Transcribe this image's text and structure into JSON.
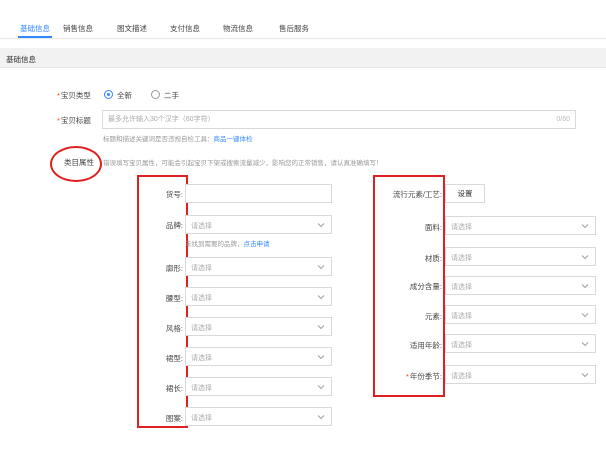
{
  "tabs": [
    {
      "label": "基础信息",
      "active": true
    },
    {
      "label": "销售信息",
      "active": false
    },
    {
      "label": "图文描述",
      "active": false
    },
    {
      "label": "支付信息",
      "active": false
    },
    {
      "label": "物流信息",
      "active": false
    },
    {
      "label": "售后服务",
      "active": false
    }
  ],
  "section": {
    "title": "基础信息"
  },
  "item_type": {
    "required_mark": "*",
    "label": "宝贝类型",
    "options": [
      {
        "label": "全新",
        "checked": true
      },
      {
        "label": "二手",
        "checked": false
      }
    ]
  },
  "item_title": {
    "required_mark": "*",
    "label": "宝贝标题",
    "placeholder": "最多允许输入30个汉字（60字符）",
    "counter": "0/60",
    "hint": "标题和描述关键词是否违规自检工具：",
    "hint_link": "商品一键体检"
  },
  "category_attrs": {
    "label": "类目属性",
    "hint": "错误填写宝贝属性，可能会引起宝贝下架或搜索流量减少，影响您的正常销售，请认真准确填写！"
  },
  "left_fields": [
    {
      "label": "货号:",
      "kind": "input",
      "placeholder": ""
    },
    {
      "label": "品牌:",
      "kind": "select",
      "placeholder": "请选择",
      "hint": "未找到需要的品牌，",
      "hint_link": "点击申请"
    },
    {
      "label": "廓形:",
      "kind": "select",
      "placeholder": "请选择"
    },
    {
      "label": "腰型:",
      "kind": "select",
      "placeholder": "请选择"
    },
    {
      "label": "风格:",
      "kind": "select",
      "placeholder": "请选择"
    },
    {
      "label": "裙型:",
      "kind": "select",
      "placeholder": "请选择"
    },
    {
      "label": "裙长:",
      "kind": "select",
      "placeholder": "请选择"
    },
    {
      "label": "图案:",
      "kind": "select",
      "placeholder": "请选择"
    }
  ],
  "right_fields": [
    {
      "label": "流行元素/工艺:",
      "kind": "button",
      "button_label": "设置"
    },
    {
      "label": "面料:",
      "kind": "select",
      "placeholder": "请选择"
    },
    {
      "label": "材质:",
      "kind": "select",
      "placeholder": "请选择"
    },
    {
      "label": "成分含量:",
      "kind": "select",
      "placeholder": "请选择"
    },
    {
      "label": "元素:",
      "kind": "select",
      "placeholder": "请选择"
    },
    {
      "label": "适用年龄:",
      "kind": "select",
      "placeholder": "请选择"
    },
    {
      "label": "年份季节:",
      "kind": "select",
      "placeholder": "请选择",
      "required_mark": "*"
    }
  ],
  "colors": {
    "accent": "#3388ff",
    "annotation": "#e02020",
    "required": "#ff4400"
  }
}
